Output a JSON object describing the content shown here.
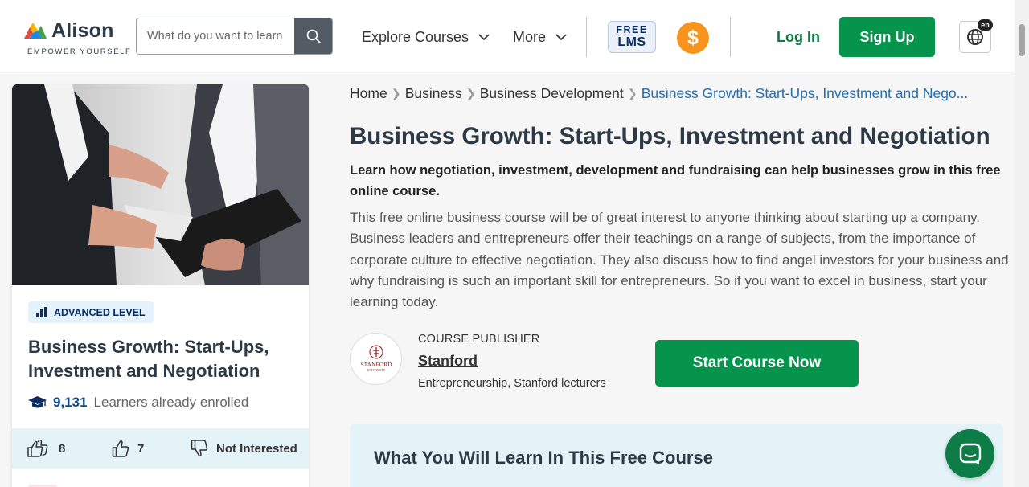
{
  "header": {
    "logo_word": "Alison",
    "logo_tagline": "EMPOWER YOURSELF",
    "search_placeholder": "What do you want to learn",
    "nav": [
      {
        "label": "Explore Courses"
      },
      {
        "label": "More"
      }
    ],
    "free_lms": {
      "line1": "FREE",
      "line2": "LMS"
    },
    "coin_symbol": "$",
    "login_label": "Log In",
    "signup_label": "Sign Up",
    "language_badge": "en"
  },
  "card": {
    "level": "ADVANCED LEVEL",
    "title": "Business Growth: Start-Ups, Investment and Negotiation",
    "learners_count": "9,131",
    "learners_text": "Learners already enrolled",
    "likes": "8",
    "thumbs_up": "7",
    "not_interested": "Not Interested"
  },
  "breadcrumb": {
    "items": [
      "Home",
      "Business",
      "Business Development"
    ],
    "current": "Business Growth: Start-Ups, Investment and Nego..."
  },
  "course": {
    "title": "Business Growth: Start-Ups, Investment and Negotiation",
    "subtitle": "Learn how negotiation, investment, development and fundraising can help businesses grow in this free online course.",
    "description": "This free online business course will be of great interest to anyone thinking about starting up a company. Business leaders and entrepreneurs offer their teachings on a range of subjects, from the importance of corporate culture to effective negotiation. They also discuss how to find angel investors for your business and why fundraising is such an important skill for entrepreneurs. So if you want to excel in business, start your learning today.",
    "publisher_label": "COURSE PUBLISHER",
    "publisher_name": "Stanford",
    "publisher_logo_text": "STANFORD",
    "publisher_logo_sub": "UNIVERSITY",
    "publisher_desc": "Entrepreneurship, Stanford lecturers",
    "start_label": "Start Course Now",
    "learn_heading": "What You Will Learn In This Free Course"
  },
  "colors": {
    "brand_green": "#06944d",
    "navy": "#0b2d63",
    "link_blue": "#1d6fb5",
    "coin_orange": "#f7941d",
    "light_blue_bg": "#e4f3f8"
  }
}
